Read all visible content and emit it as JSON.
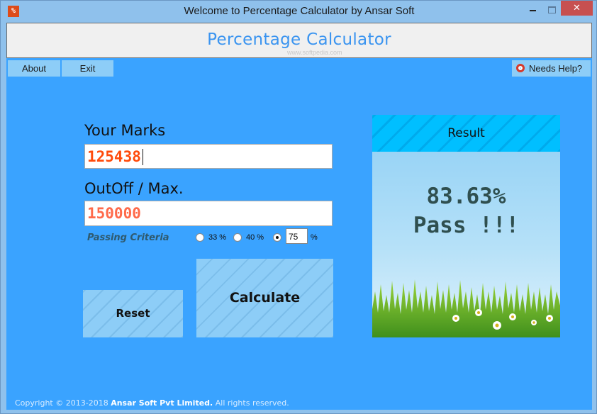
{
  "window": {
    "title": "Welcome to Percentage Calculator by Ansar Soft",
    "app_icon_glyph": "%",
    "close_glyph": "✕"
  },
  "header": {
    "title": "Percentage Calculator",
    "watermark": "www.softpedia.com"
  },
  "nav": {
    "about_label": "About",
    "exit_label": "Exit",
    "help_label": "Needs Help?",
    "help_icon": "lifebuoy-icon"
  },
  "form": {
    "marks_label": "Your Marks",
    "marks_value": "125438",
    "max_label": "OutOff / Max.",
    "max_value": "150000",
    "criteria_label": "Passing Criteria",
    "criteria_options": [
      {
        "label": "33 %",
        "checked": false
      },
      {
        "label": "40 %",
        "checked": false
      },
      {
        "label": "custom",
        "checked": true
      }
    ],
    "custom_criteria_value": "75",
    "custom_criteria_suffix": "%"
  },
  "actions": {
    "reset_label": "Reset",
    "calculate_label": "Calculate"
  },
  "result": {
    "header": "Result",
    "percentage": "83.63%",
    "status": "Pass !!!"
  },
  "footer": {
    "prefix": "Copyright © 2013-2018",
    "company": "Ansar Soft Pvt Limited.",
    "suffix": "All rights reserved."
  },
  "colors": {
    "main_bg": "#3aa3ff",
    "button_bg": "#8dcdf7",
    "result_header": "#00bfff",
    "marks_text": "#ff4a0a",
    "header_title": "#3a94f0"
  }
}
